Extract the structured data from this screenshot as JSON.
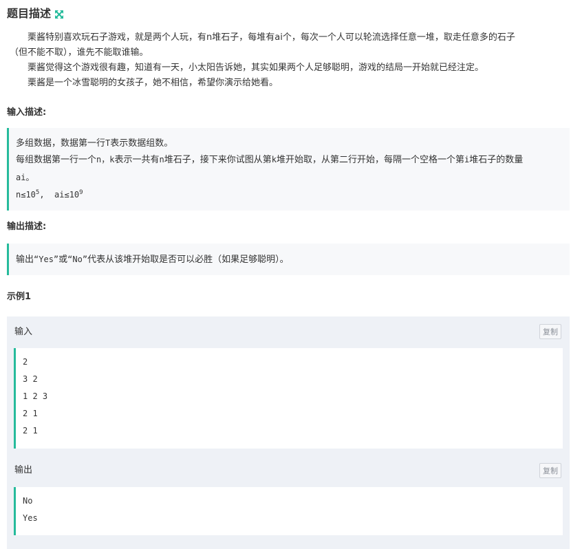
{
  "problem": {
    "title": "题目描述",
    "description": {
      "p1_line1": "栗酱特别喜欢玩石子游戏，就是两个人玩，有n堆石子，每堆有ai个，每次一个人可以轮流选择任意一堆，取走任意多的石子",
      "p1_line2": "（但不能不取），谁先不能取谁输。",
      "p2": "栗酱觉得这个游戏很有趣，知道有一天，小太阳告诉她，其实如果两个人足够聪明，游戏的结局一开始就已经注定。",
      "p3": "栗酱是一个冰雪聪明的女孩子，她不相信，希望你演示给她看。"
    }
  },
  "input_desc": {
    "heading": "输入描述:",
    "line1_a": "多组数据，数据第一行",
    "line1_code": "T",
    "line1_b": "表示数据组数。",
    "line2_a": "每组数据第一行一个",
    "line2_code1": "n，",
    "line2_code2": "k",
    "line2_b": "表示一共有",
    "line2_code3": "n",
    "line2_c": "堆石子，接下来你试图从第",
    "line2_code4": "k",
    "line2_d": "堆开始取，从第二行开始，每隔一个空格一个第",
    "line2_code5": "i",
    "line2_e": "堆石子的数量",
    "line3": "ai。",
    "constraint_n": "n≤10",
    "constraint_n_exp": "5",
    "constraint_sep": ",  ",
    "constraint_ai": "ai≤10",
    "constraint_ai_exp": "9"
  },
  "output_desc": {
    "heading": "输出描述:",
    "text_a": "输出",
    "text_code1": "“Yes”",
    "text_b": "或",
    "text_code2": "“No”",
    "text_c": "代表从该堆开始取是否可以必胜（如果足够聪明）。"
  },
  "example": {
    "heading": "示例1",
    "input_label": "输入",
    "output_label": "输出",
    "copy_label": "复制",
    "input_lines": [
      "2",
      "3 2",
      "1 2 3",
      "2 1",
      "2 1"
    ],
    "output_lines": [
      "No",
      "Yes"
    ]
  },
  "colors": {
    "accent": "#25bb9b",
    "card_bg": "#eef1f6",
    "quote_bg": "#f7f8fa"
  }
}
